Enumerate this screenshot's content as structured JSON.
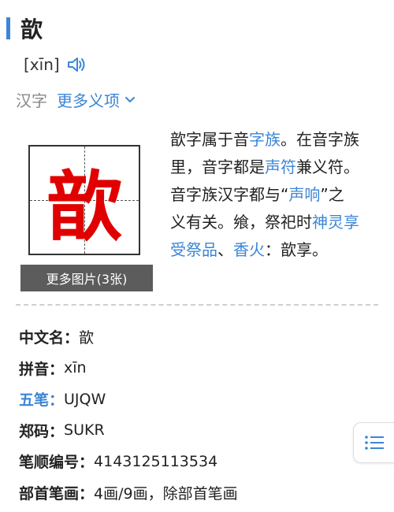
{
  "header": {
    "title": "歆",
    "pinyin": "[xīn]"
  },
  "nav": {
    "category": "汉字",
    "more_label": "更多义项"
  },
  "image": {
    "glyph": "歆",
    "more_pictures": "更多图片(3张)"
  },
  "description": {
    "segments": [
      "歆字属于音",
      "字族",
      "。在音字族里，音字都是",
      "声符",
      "兼义符。音字族汉字都与“",
      "声响",
      "”之义有关。飨，祭祀时",
      "神灵享受祭品",
      "、",
      "香火",
      "：歆享。"
    ]
  },
  "info": {
    "rows": [
      {
        "label": "中文名：",
        "value": "歆"
      },
      {
        "label": "拼音：",
        "value": "xīn"
      },
      {
        "label": "五笔：",
        "value": "UJQW"
      },
      {
        "label": "郑码：",
        "value": "SUKR"
      },
      {
        "label": "笔顺编号：",
        "value": "4143125113534"
      },
      {
        "label": "部首笔画：",
        "value": "4画/9画，除部首笔画"
      }
    ]
  },
  "colors": {
    "accent": "#3b86d6",
    "glyph_red": "#e00000",
    "button_gray": "#5c5c5c"
  },
  "icons": {
    "speaker": "speaker-icon",
    "chevron": "chevron-down-icon",
    "toc": "table-of-contents-icon"
  }
}
